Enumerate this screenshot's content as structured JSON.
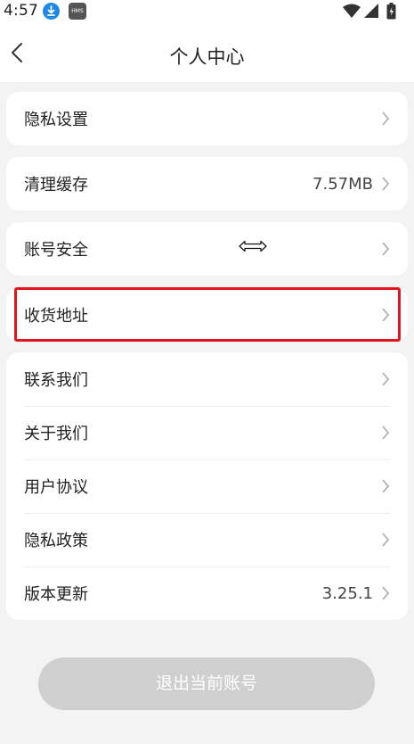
{
  "status_bar": {
    "time": "4:57",
    "hms_label": "HMS"
  },
  "header": {
    "title": "个人中心"
  },
  "settings": {
    "privacy_settings": "隐私设置",
    "clear_cache": "清理缓存",
    "cache_size": "7.57MB",
    "account_security": "账号安全",
    "shipping_address": "收货地址",
    "contact_us": "联系我们",
    "about_us": "关于我们",
    "user_agreement": "用户协议",
    "privacy_policy": "隐私政策",
    "version_update": "版本更新",
    "version_number": "3.25.1"
  },
  "logout": {
    "label": "退出当前账号"
  },
  "colors": {
    "highlight": "#e3141c",
    "download_badge": "#1e88e5",
    "button_disabled": "#cfcfcf"
  }
}
